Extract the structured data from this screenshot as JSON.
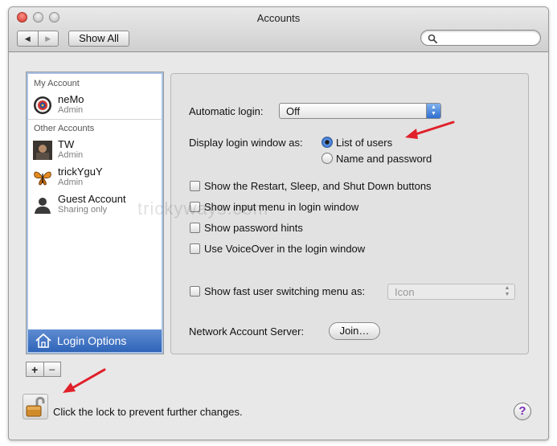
{
  "window": {
    "title": "Accounts"
  },
  "toolbar": {
    "back_glyph": "◀",
    "forward_glyph": "▶",
    "show_all_label": "Show All",
    "search_placeholder": ""
  },
  "sidebar": {
    "my_account_header": "My Account",
    "other_accounts_header": "Other Accounts",
    "users": [
      {
        "name": "neMo",
        "role": "Admin",
        "icon": "target-avatar"
      },
      {
        "name": "TW",
        "role": "Admin",
        "icon": "photo-avatar"
      },
      {
        "name": "trickYguY",
        "role": "Admin",
        "icon": "butterfly-avatar"
      },
      {
        "name": "Guest Account",
        "role": "Sharing only",
        "icon": "person-silhouette-avatar"
      }
    ],
    "login_options_label": "Login Options",
    "add_glyph": "+",
    "remove_glyph": "−"
  },
  "login_options": {
    "automatic_login_label": "Automatic login:",
    "automatic_login_value": "Off",
    "display_as_label": "Display login window as:",
    "display_options": [
      {
        "label": "List of users",
        "selected": true
      },
      {
        "label": "Name and password",
        "selected": false
      }
    ],
    "checkboxes": [
      {
        "label": "Show the Restart, Sleep, and Shut Down buttons",
        "checked": false
      },
      {
        "label": "Show input menu in login window",
        "checked": false
      },
      {
        "label": "Show password hints",
        "checked": false
      },
      {
        "label": "Use VoiceOver in the login window",
        "checked": false
      }
    ],
    "fast_switch_label": "Show fast user switching menu as:",
    "fast_switch_checked": false,
    "fast_switch_value": "Icon",
    "network_server_label": "Network Account Server:",
    "join_label": "Join…"
  },
  "footer": {
    "lock_text": "Click the lock to prevent further changes.",
    "help_glyph": "?"
  },
  "watermark": "trickyways.com",
  "colors": {
    "accent": "#2f64b8",
    "annotation_arrow": "#e0202a"
  }
}
